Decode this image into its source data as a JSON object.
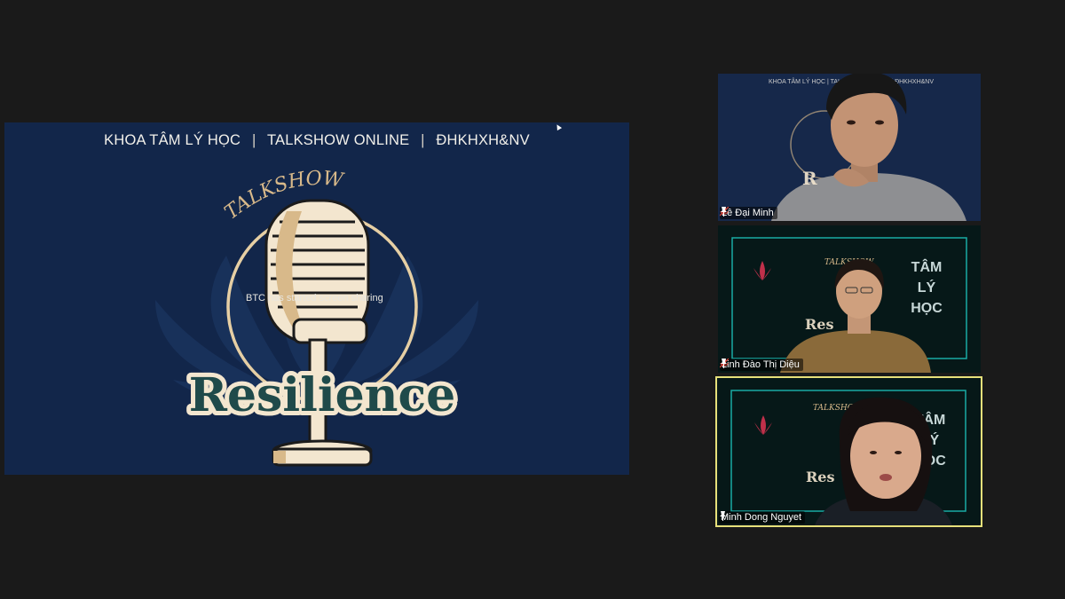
{
  "shared_screen": {
    "header": [
      "KHOA TÂM LÝ HỌC",
      "TALKSHOW ONLINE",
      "ĐHKHXH&NV"
    ],
    "separator": "|",
    "logo_arc_text": "TALKSHOW",
    "logo_title": "Resilience",
    "toast": "BTC has started screen sharing",
    "colors": {
      "background": "#12264a",
      "cream": "#f3e6cf",
      "gold": "#d8b98a"
    }
  },
  "participants": [
    {
      "name": "Lê Đại Minh",
      "muted": true,
      "pinned": true,
      "active_speaker": false,
      "backdrop_text": "KHOA TÂM LÝ HỌC | TALKSHOW ONLINE | ĐHKHXH&NV"
    },
    {
      "name": "Linh Đào Thị Diệu",
      "muted": true,
      "pinned": true,
      "active_speaker": false,
      "backdrop_text": [
        "TÂM",
        "LÝ",
        "HỌC"
      ],
      "backdrop_logo": "TALKSHOW"
    },
    {
      "name": "Minh Dong Nguyet",
      "muted": false,
      "pinned": true,
      "active_speaker": true,
      "backdrop_text": [
        "TÂM",
        "LÝ",
        "HỌC"
      ],
      "backdrop_logo": "TALKSHOW"
    }
  ],
  "colors": {
    "app_background": "#1a1a1a",
    "active_speaker_border": "#e6e07a",
    "muted_icon": "#e0453a"
  }
}
